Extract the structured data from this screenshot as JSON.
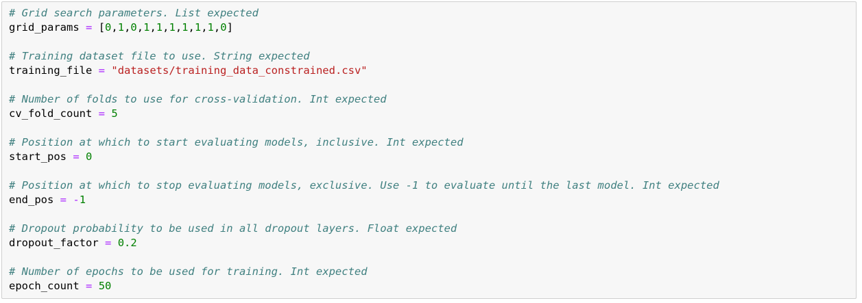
{
  "cell": {
    "blocks": [
      {
        "comment": "# Grid search parameters. List expected",
        "var": "grid_params",
        "value_type": "list",
        "list_values": [
          "0",
          "1",
          "0",
          "1",
          "1",
          "1",
          "1",
          "1",
          "1",
          "0"
        ]
      },
      {
        "comment": "# Training dataset file to use. String expected",
        "var": "training_file",
        "value_type": "string",
        "value": "\"datasets/training_data_constrained.csv\""
      },
      {
        "comment": "# Number of folds to use for cross-validation. Int expected",
        "var": "cv_fold_count",
        "value_type": "number",
        "value": "5"
      },
      {
        "comment": "# Position at which to start evaluating models, inclusive. Int expected",
        "var": "start_pos",
        "value_type": "number",
        "value": "0"
      },
      {
        "comment": "# Position at which to stop evaluating models, exclusive. Use -1 to evaluate until the last model. Int expected",
        "var": "end_pos",
        "value_type": "neg_number",
        "value": "1"
      },
      {
        "comment": "# Dropout probability to be used in all dropout layers. Float expected",
        "var": "dropout_factor",
        "value_type": "number",
        "value": "0.2"
      },
      {
        "comment": "# Number of epochs to be used for training. Int expected",
        "var": "epoch_count",
        "value_type": "number",
        "value": "50"
      }
    ],
    "tokens": {
      "assign": "=",
      "minus": "-",
      "list_open": "[",
      "list_close": "]",
      "separator": ","
    },
    "colors": {
      "comment": "#408080",
      "operator": "#aa22ff",
      "number": "#008000",
      "string": "#ba2121",
      "cell_background": "#f7f7f7",
      "cell_border": "#cfcfcf"
    }
  }
}
